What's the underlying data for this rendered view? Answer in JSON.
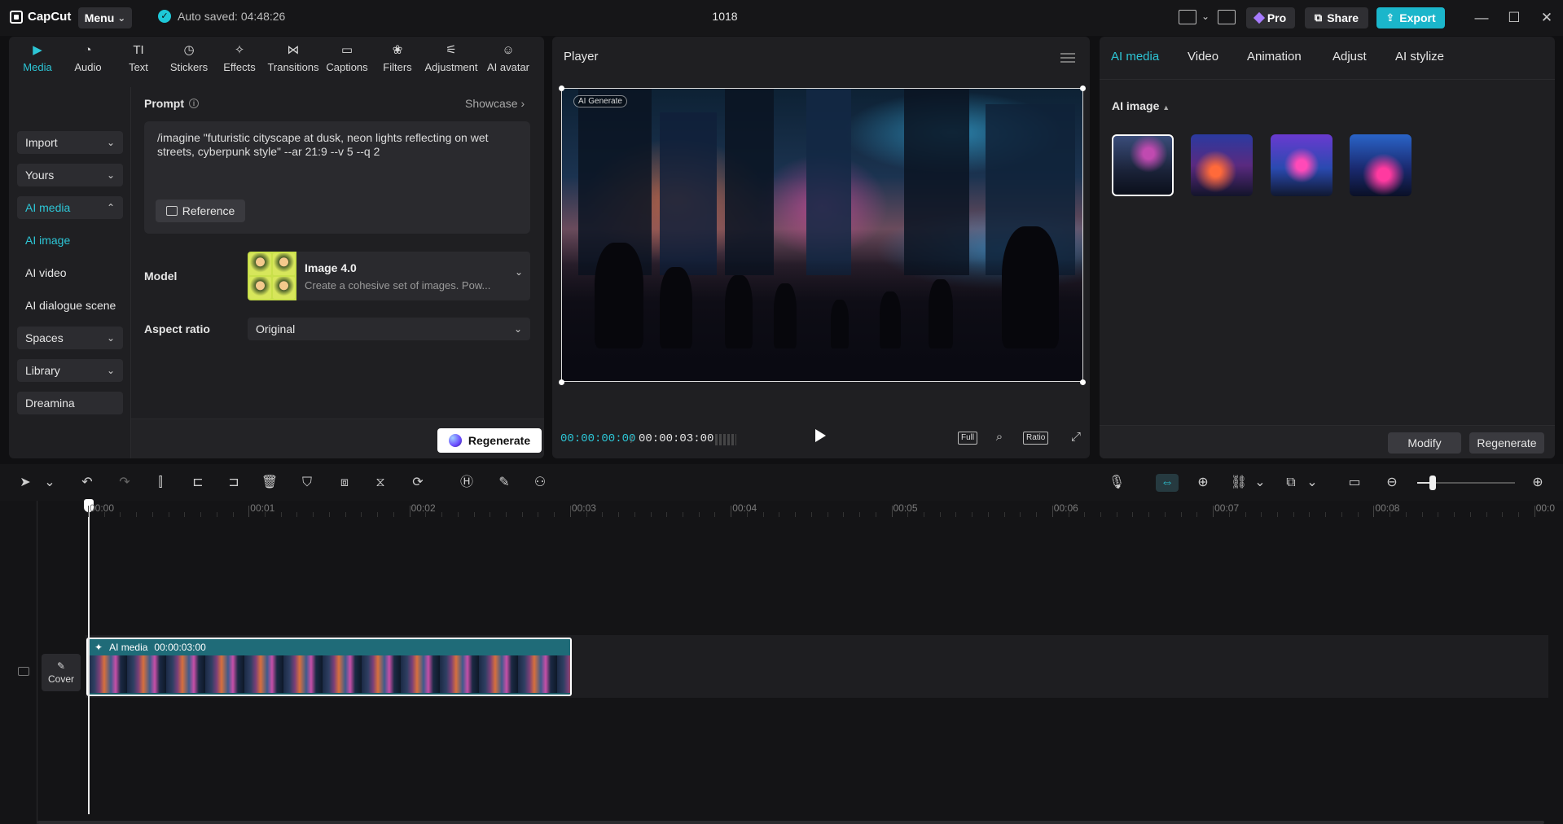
{
  "app": {
    "name": "CapCut",
    "menu_label": "Menu",
    "autosave": "Auto saved: 04:48:26",
    "project_title": "1018",
    "pro_label": "Pro",
    "share_label": "Share",
    "export_label": "Export",
    "accent_color": "#2dc6d6"
  },
  "left_tabs": [
    {
      "label": "Media",
      "icon": "media-icon"
    },
    {
      "label": "Audio",
      "icon": "audio-icon"
    },
    {
      "label": "Text",
      "icon": "text-icon"
    },
    {
      "label": "Stickers",
      "icon": "sticker-icon"
    },
    {
      "label": "Effects",
      "icon": "effects-icon"
    },
    {
      "label": "Transitions",
      "icon": "transitions-icon"
    },
    {
      "label": "Captions",
      "icon": "captions-icon"
    },
    {
      "label": "Filters",
      "icon": "filters-icon"
    },
    {
      "label": "Adjustment",
      "icon": "adjustment-icon"
    },
    {
      "label": "AI avatar",
      "icon": "ai-avatar-icon"
    }
  ],
  "sidebar": {
    "import": "Import",
    "yours": "Yours",
    "ai_media": "AI media",
    "ai_image": "AI image",
    "ai_video": "AI video",
    "ai_dialogue": "AI dialogue scene",
    "spaces": "Spaces",
    "library": "Library",
    "dreamina": "Dreamina"
  },
  "prompt": {
    "label": "Prompt",
    "showcase": "Showcase",
    "text": "/imagine \"futuristic cityscape at dusk, neon lights reflecting on wet streets, cyberpunk style\" --ar 21:9 --v 5 --q 2",
    "reference_label": "Reference"
  },
  "model": {
    "label": "Model",
    "name": "Image 4.0",
    "description": "Create a cohesive set of images. Pow..."
  },
  "aspect_ratio": {
    "label": "Aspect ratio",
    "value": "Original"
  },
  "regenerate_label": "Regenerate",
  "player": {
    "title": "Player",
    "ai_tag": "AI Generate",
    "current_time": "00:00:00:00",
    "separator": "/",
    "total_time": "00:00:03:00",
    "full_label": "Full",
    "ratio_label": "Ratio"
  },
  "right_tabs": [
    "AI media",
    "Video",
    "Animation",
    "Adjust",
    "AI stylize"
  ],
  "ai_image_label": "AI image",
  "right_footer": {
    "modify": "Modify",
    "regenerate": "Regenerate"
  },
  "timeline": {
    "ruler": [
      "00:00",
      "00:01",
      "00:02",
      "00:03",
      "00:04",
      "00:05",
      "00:06",
      "00:07",
      "00:08",
      "00:0"
    ],
    "clip_label": "AI media",
    "clip_duration": "00:00:03:00",
    "cover_label": "Cover"
  }
}
